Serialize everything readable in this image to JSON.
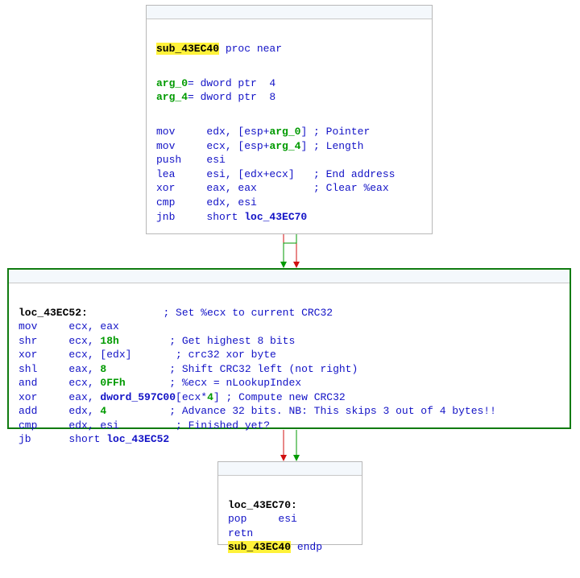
{
  "node1": {
    "id": "sub_43EC40",
    "sub_name": "sub_43EC40",
    "proc_near": " proc near",
    "arg0_label": "arg_0",
    "arg0_rest": "= dword ptr  4",
    "arg4_label": "arg_4",
    "arg4_rest": "= dword ptr  8",
    "l1a": "mov     edx, [esp+",
    "l1b": "arg_0",
    "l1c": "] ; Pointer",
    "l2a": "mov     ecx, [esp+",
    "l2b": "arg_4",
    "l2c": "] ; Length",
    "l3": "push    esi",
    "l4": "lea     esi, [edx+ecx]   ; End address",
    "l5": "xor     eax, eax         ; Clear %eax",
    "l6": "cmp     edx, esi",
    "l7": "jnb     short ",
    "l7_target": "loc_43EC70"
  },
  "node2": {
    "id": "loc_43EC52",
    "label": "loc_43EC52:",
    "label_cmt": "            ; Set %ecx to current CRC32",
    "l1": "mov     ecx, eax",
    "l2a": "shr     ecx, ",
    "l2b": "18h",
    "l2c": "        ; Get highest 8 bits",
    "l3": "xor     ecx, [edx]       ; crc32 xor byte",
    "l4a": "shl     eax, ",
    "l4b": "8",
    "l4c": "          ; Shift CRC32 left (not right)",
    "l5a": "and     ecx, ",
    "l5b": "0FFh",
    "l5c": "       ; %ecx = nLookupIndex",
    "l6a": "xor     eax, ",
    "l6b": "dword_597C00",
    "l6c": "[ecx*",
    "l6d": "4",
    "l6e": "] ; Compute new CRC32",
    "l7a": "add     edx, ",
    "l7b": "4",
    "l7c": "          ; Advance 32 bits. NB: This skips 3 out of 4 bytes!!",
    "l8": "cmp     edx, esi         ; Finished yet?",
    "l9": "jb      short ",
    "l9_target": "loc_43EC52"
  },
  "node3": {
    "id": "loc_43EC70",
    "label": "loc_43EC70:",
    "l1": "pop     esi",
    "l2": "retn",
    "endp_name": "sub_43EC40",
    "endp_kw": " endp"
  },
  "colors": {
    "true_edge": "#009a00",
    "false_edge": "#d01010"
  }
}
